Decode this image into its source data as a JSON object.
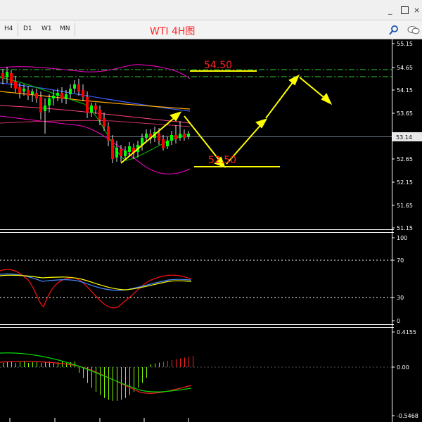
{
  "window": {
    "minimize_glyph": "_",
    "restore_glyph": "×",
    "close_glyph": "×"
  },
  "toolbar": {
    "timeframes": [
      "H4",
      "D1",
      "W1",
      "MN"
    ],
    "chart_title": "WTI 4H图",
    "search_icon": "search-icon",
    "chat_icon": "chat-icon"
  },
  "colors": {
    "bull_candle": "#00ff00",
    "bear_candle": "#ff0000",
    "annotation": "#ffff00",
    "annotation_text": "#ff2020",
    "band": "#ff00cc",
    "grid_dash": "#ffffff"
  },
  "chart_data": [
    {
      "type": "line",
      "name": "price-pane",
      "y_ticks": [
        "55.15",
        "54.65",
        "54.15",
        "53.65",
        "53.14",
        "52.65",
        "52.15",
        "51.65",
        "51.15"
      ],
      "current_price": "53.14",
      "annotations": [
        "54.50",
        "52.50"
      ],
      "ylim": [
        51.15,
        55.15
      ]
    },
    {
      "type": "line",
      "name": "oscillator-pane",
      "y_ticks": [
        "100",
        "70",
        "30",
        "0"
      ],
      "ylim": [
        0,
        100
      ]
    },
    {
      "type": "bar",
      "name": "macd-pane",
      "y_ticks": [
        "0.4155",
        "0.00",
        "-0.5468"
      ],
      "ylim": [
        -0.5468,
        0.4155
      ]
    }
  ]
}
